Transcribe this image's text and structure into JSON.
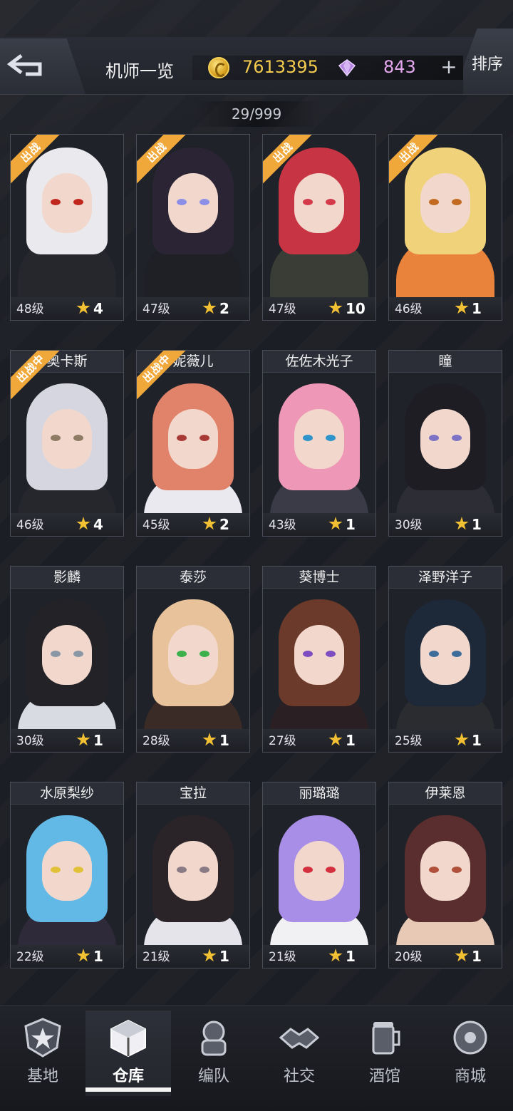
{
  "header": {
    "title": "机师一览",
    "coins": "7613395",
    "gems": "843",
    "plus_label": "+",
    "sort_label": "排序"
  },
  "roster_count": "29/999",
  "pilots": [
    {
      "name": "",
      "level": "48级",
      "stars": "4",
      "badge": "出战",
      "hair": "#e9e9ee",
      "outfit": "#26272d",
      "eye": "#c0281e"
    },
    {
      "name": "",
      "level": "47级",
      "stars": "2",
      "badge": "出战",
      "hair": "#2a2434",
      "outfit": "#1f2025",
      "eye": "#8b8fe8"
    },
    {
      "name": "",
      "level": "47级",
      "stars": "10",
      "badge": "出战",
      "hair": "#c73443",
      "outfit": "#3a3d36",
      "eye": "#d23a4a"
    },
    {
      "name": "",
      "level": "46级",
      "stars": "1",
      "badge": "出战",
      "hair": "#f0d27a",
      "outfit": "#e9823a",
      "eye": "#c26a20"
    },
    {
      "name": "奥卡斯",
      "level": "46级",
      "stars": "4",
      "badge": "出战中",
      "hair": "#d6d6e0",
      "outfit": "#26272c",
      "eye": "#8d7b63"
    },
    {
      "name": "妮薇儿",
      "level": "45级",
      "stars": "2",
      "badge": "出战中",
      "hair": "#e1836a",
      "outfit": "#e9e9ef",
      "eye": "#a83a36"
    },
    {
      "name": "佐佐木光子",
      "level": "43级",
      "stars": "1",
      "badge": "",
      "hair": "#ef97b6",
      "outfit": "#3a3b46",
      "eye": "#2e93c9"
    },
    {
      "name": "瞳",
      "level": "30级",
      "stars": "1",
      "badge": "",
      "hair": "#1f1d24",
      "outfit": "#2d2e35",
      "eye": "#7d72c4"
    },
    {
      "name": "影麟",
      "level": "30级",
      "stars": "1",
      "badge": "",
      "hair": "#232227",
      "outfit": "#d9dbe3",
      "eye": "#8a97a4"
    },
    {
      "name": "泰莎",
      "level": "28级",
      "stars": "1",
      "badge": "",
      "hair": "#e8c29a",
      "outfit": "#3b2b26",
      "eye": "#3ab14a"
    },
    {
      "name": "葵博士",
      "level": "27级",
      "stars": "1",
      "badge": "",
      "hair": "#6b3a2a",
      "outfit": "#2a2023",
      "eye": "#7e4cc0"
    },
    {
      "name": "泽野洋子",
      "level": "25级",
      "stars": "1",
      "badge": "",
      "hair": "#1d2838",
      "outfit": "#2b2c30",
      "eye": "#3f6d9a"
    },
    {
      "name": "水原梨纱",
      "level": "22级",
      "stars": "1",
      "badge": "",
      "hair": "#62b9e6",
      "outfit": "#2f2a3a",
      "eye": "#e1c03a"
    },
    {
      "name": "宝拉",
      "level": "21级",
      "stars": "1",
      "badge": "",
      "hair": "#2a2428",
      "outfit": "#e4e4ea",
      "eye": "#8a7a86"
    },
    {
      "name": "丽璐璐",
      "level": "21级",
      "stars": "1",
      "badge": "",
      "hair": "#a98ee8",
      "outfit": "#f1f1f4",
      "eye": "#d2303e"
    },
    {
      "name": "伊莱恩",
      "level": "20级",
      "stars": "1",
      "badge": "",
      "hair": "#5a2e2e",
      "outfit": "#e7c9b5",
      "eye": "#b0503a"
    }
  ],
  "nav": [
    {
      "label": "基地",
      "icon": "base-icon",
      "active": false
    },
    {
      "label": "仓库",
      "icon": "warehouse-icon",
      "active": true
    },
    {
      "label": "编队",
      "icon": "formation-icon",
      "active": false
    },
    {
      "label": "社交",
      "icon": "handshake-icon",
      "active": false
    },
    {
      "label": "酒馆",
      "icon": "tavern-icon",
      "active": false
    },
    {
      "label": "商城",
      "icon": "shop-icon",
      "active": false
    }
  ],
  "colors": {
    "gold": "#f4cb4e",
    "gem": "#e4a7ee",
    "badge": "#f1a83a",
    "star": "#f2c033"
  }
}
